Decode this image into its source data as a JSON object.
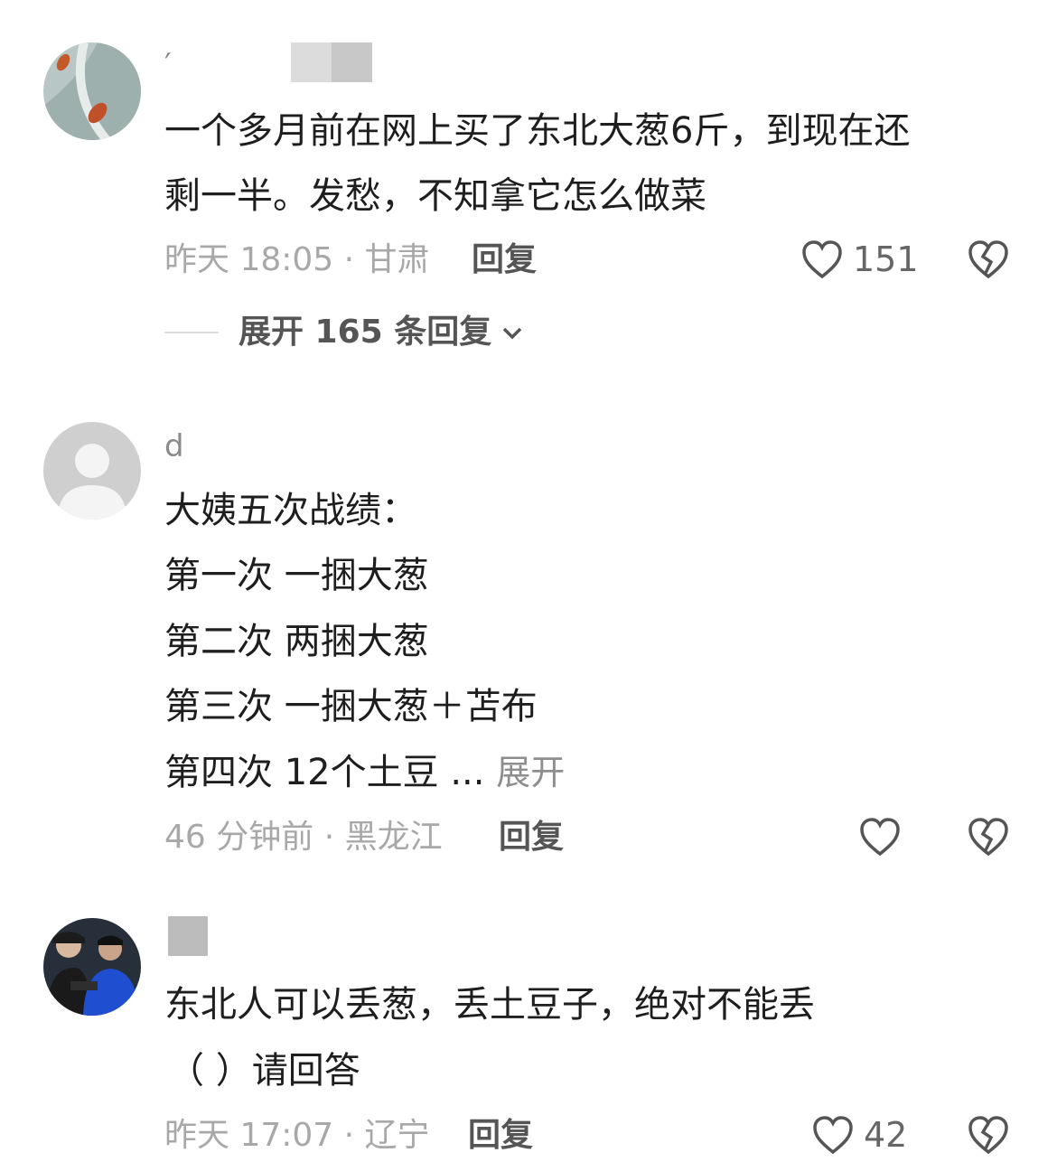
{
  "comments": [
    {
      "username": "′",
      "text_lines": [
        "一个多月前在网上买了东北大葱6斤，到现在还",
        "剩一半。发愁，不知拿它怎么做菜"
      ],
      "time_location": "昨天 18:05 · 甘肃",
      "reply_label": "回复",
      "likes": "151",
      "expand_replies": "展开 165 条回复"
    },
    {
      "username": "d",
      "text_lines": [
        "大姨五次战绩：",
        "第一次  一捆大葱",
        "第二次  两捆大葱",
        "第三次  一捆大葱＋苫布",
        "第四次  12个土豆 ..."
      ],
      "expand_more": "展开",
      "time_location": "46 分钟前 · 黑龙江",
      "reply_label": "回复",
      "likes": ""
    },
    {
      "username": "",
      "text_lines": [
        "东北人可以丢葱，丢土豆子，绝对不能丢",
        "（    ）请回答"
      ],
      "time_location": "昨天 17:07 · 辽宁",
      "reply_label": "回复",
      "likes": "42"
    }
  ],
  "colors": {
    "meta_text": "#a8a8a8",
    "reply_text": "#555555",
    "body_text": "#1e1e1e"
  },
  "icons": {
    "like": "heart-outline-icon",
    "dislike": "broken-heart-icon",
    "expand": "chevron-down-icon"
  }
}
